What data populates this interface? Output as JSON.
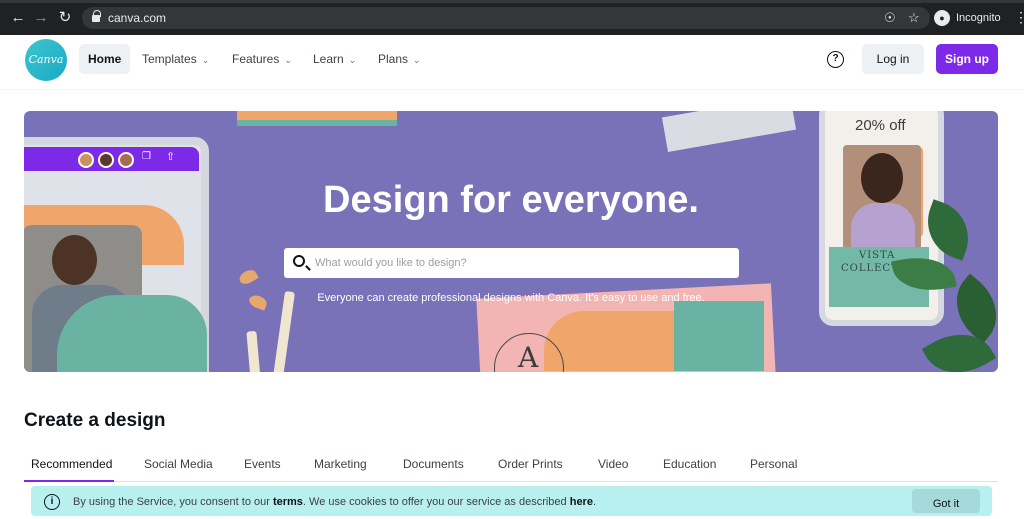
{
  "browser": {
    "url": "canva.com",
    "profile_label": "Incognito"
  },
  "header": {
    "logo_text": "Canva",
    "nav": [
      {
        "label": "Home"
      },
      {
        "label": "Templates"
      },
      {
        "label": "Features"
      },
      {
        "label": "Learn"
      },
      {
        "label": "Plans"
      }
    ],
    "help_label": "?",
    "login_label": "Log in",
    "signup_label": "Sign up"
  },
  "hero": {
    "title": "Design for everyone.",
    "search_placeholder": "What would you like to design?",
    "subtitle": "Everyone can create professional designs with Canva. It's easy to use and free.",
    "phone_sale": "20% off",
    "phone_text_line1": "VISTA",
    "phone_text_line2": "COLLECT",
    "card_letter": "A"
  },
  "create": {
    "heading": "Create a design",
    "tabs": [
      {
        "label": "Recommended"
      },
      {
        "label": "Social Media"
      },
      {
        "label": "Events"
      },
      {
        "label": "Marketing"
      },
      {
        "label": "Documents"
      },
      {
        "label": "Order Prints"
      },
      {
        "label": "Video"
      },
      {
        "label": "Education"
      },
      {
        "label": "Personal"
      }
    ]
  },
  "cookie": {
    "text_pre": "By using the Service, you consent to our ",
    "terms_link": "terms",
    "text_mid": ". We use cookies to offer you our service as described ",
    "here_link": "here",
    "text_post": ".",
    "button_label": "Got it"
  },
  "colors": {
    "brand_purple": "#7d2ae8",
    "logo_teal": "#19a9c4",
    "hero_bg": "#7a72b9",
    "cookie_bg": "#b8f0f0"
  }
}
